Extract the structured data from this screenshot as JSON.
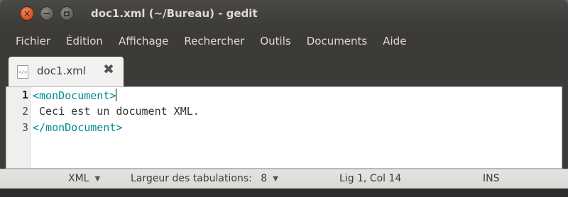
{
  "window": {
    "title": "doc1.xml (~/Bureau) - gedit",
    "close_glyph": "×"
  },
  "menu": {
    "items": [
      "Fichier",
      "Édition",
      "Affichage",
      "Rechercher",
      "Outils",
      "Documents",
      "Aide"
    ]
  },
  "tab": {
    "label": "doc1.xml",
    "icon_text": "</>",
    "close_glyph": "✖"
  },
  "editor": {
    "line_numbers": [
      "1",
      "2",
      "3"
    ],
    "lines": [
      {
        "text": "<monDocument>",
        "kind": "tag"
      },
      {
        "text": " Ceci est un document XML.",
        "kind": "plain"
      },
      {
        "text": "</monDocument>",
        "kind": "tag"
      }
    ]
  },
  "status": {
    "language": "XML",
    "tab_width_label": "Largeur des tabulations:",
    "tab_width_value": "8",
    "position": "Lig 1, Col 14",
    "mode": "INS",
    "dropdown_glyph": "▼"
  },
  "colors": {
    "xml_tag": "#008a8c",
    "close_button": "#df4a16",
    "window_chrome": "#3c3b37"
  }
}
